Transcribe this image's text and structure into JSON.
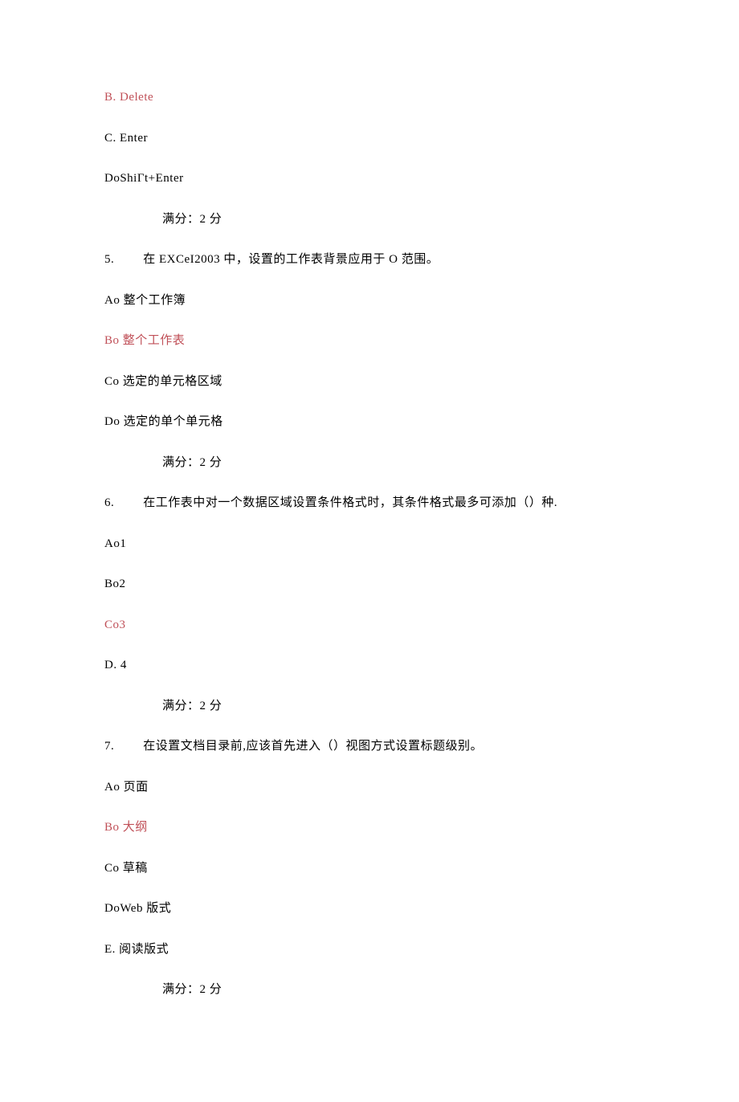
{
  "q4": {
    "optB": "B. Delete",
    "optC": "C. Enter",
    "optD": "DoShiΓt+Enter",
    "score": "满分：2 分"
  },
  "q5": {
    "num": "5.",
    "text": "在 EXCeI2003 中，设置的工作表背景应用于 O 范围。",
    "optA": "Ao 整个工作簿",
    "optB": "Bo 整个工作表",
    "optC": "Co 选定的单元格区域",
    "optD": "Do 选定的单个单元格",
    "score": "满分：2 分"
  },
  "q6": {
    "num": "6.",
    "text": "在工作表中对一个数据区域设置条件格式时，其条件格式最多可添加（）种.",
    "optA": "Ao1",
    "optB": "Bo2",
    "optC": "Co3",
    "optD": "D. 4",
    "score": "满分：2 分"
  },
  "q7": {
    "num": "7.",
    "text": "在设置文档目录前,应该首先进入（）视图方式设置标题级别。",
    "optA": "Ao 页面",
    "optB": "Bo 大纲",
    "optC": "Co 草稿",
    "optD": "DoWeb 版式",
    "optE": "E. 阅读版式",
    "score": "满分：2 分"
  }
}
